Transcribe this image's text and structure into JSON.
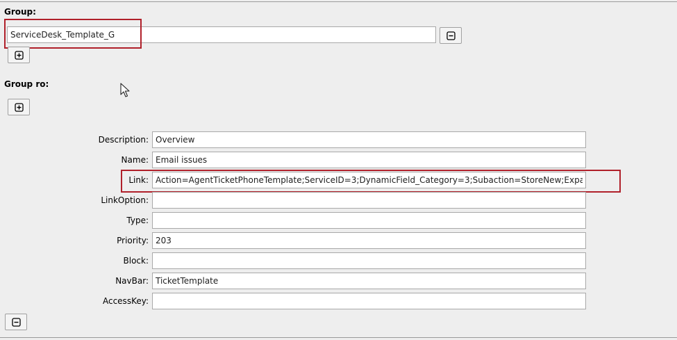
{
  "group": {
    "label": "Group:",
    "value": "ServiceDesk_Template_G",
    "remove_icon": "minus-square-icon",
    "add_icon": "plus-square-icon"
  },
  "group_ro": {
    "label": "Group ro:",
    "add_icon": "plus-square-icon"
  },
  "fields": [
    {
      "label": "Description:",
      "value": "Overview"
    },
    {
      "label": "Name:",
      "value": "Email issues"
    },
    {
      "label": "Link:",
      "value": "Action=AgentTicketPhoneTemplate;ServiceID=3;DynamicField_Category=3;Subaction=StoreNew;ExpandCustc"
    },
    {
      "label": "LinkOption:",
      "value": ""
    },
    {
      "label": "Type:",
      "value": ""
    },
    {
      "label": "Priority:",
      "value": "203"
    },
    {
      "label": "Block:",
      "value": ""
    },
    {
      "label": "NavBar:",
      "value": "TicketTemplate"
    },
    {
      "label": "AccessKey:",
      "value": ""
    }
  ],
  "remove_item_icon": "minus-square-icon",
  "highlight_color": "#b0202a"
}
